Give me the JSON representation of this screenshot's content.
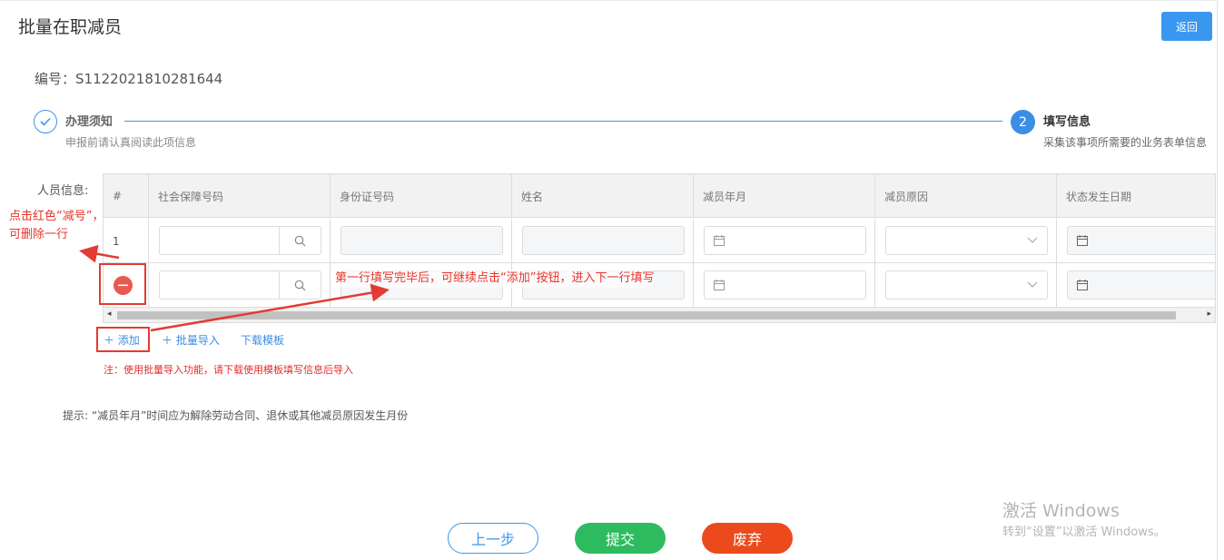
{
  "header": {
    "title": "批量在职减员",
    "back_label": "返回"
  },
  "serial": "编号：S1122021810281644",
  "steps": [
    {
      "title": "办理须知",
      "desc": "申报前请认真阅读此项信息",
      "state": "done"
    },
    {
      "index": "2",
      "title": "填写信息",
      "desc": "采集该事项所需要的业务表单信息",
      "state": "active"
    }
  ],
  "persons_label": "人员信息:",
  "table": {
    "headers": [
      "#",
      "社会保障号码",
      "身份证号码",
      "姓名",
      "减员年月",
      "减员原因",
      "状态发生日期"
    ],
    "rows": [
      {
        "num": "1"
      },
      {
        "num": ""
      }
    ]
  },
  "toolbar": {
    "add_label": "添加",
    "import_label": "批量导入",
    "template_label": "下载模板"
  },
  "note": "注：使用批量导入功能，请下载使用模板填写信息后导入",
  "hint": "提示: “减员年月”时间应为解除劳动合同、退休或其他减员原因发生月份",
  "annotations": {
    "delete_line1": "点击红色“减号”，",
    "delete_line2": "可删除一行",
    "add_note": "第一行填写完毕后，可继续点击“添加”按钮，进入下一行填写"
  },
  "footer": {
    "prev_label": "上一步",
    "submit_label": "提交",
    "discard_label": "废弃"
  },
  "watermark": {
    "title": "激活 Windows",
    "sub": "转到“设置”以激活 Windows。"
  },
  "colors": {
    "accent": "#3a97f0",
    "success": "#2ebb60",
    "danger": "#ec4a1c",
    "annotation": "#e8342a"
  }
}
